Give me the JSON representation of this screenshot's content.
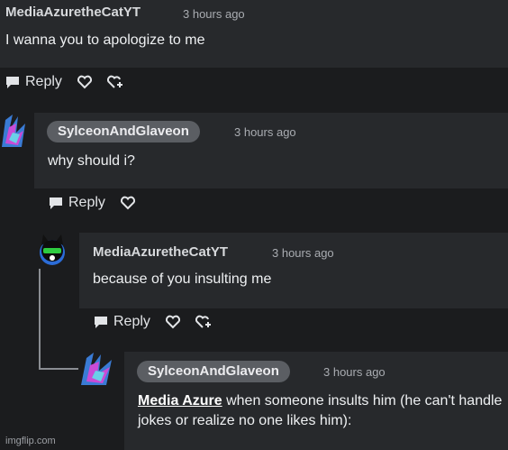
{
  "comments": [
    {
      "author": "MediaAzuretheCatYT",
      "time": "3 hours ago",
      "text": "I wanna you to apologize to me",
      "reply_label": "Reply"
    },
    {
      "author": "SylceonAndGlaveon",
      "time": "3 hours ago",
      "text": "why should i?",
      "reply_label": "Reply"
    },
    {
      "author": "MediaAzuretheCatYT",
      "time": "3 hours ago",
      "text": "because of you insulting me",
      "reply_label": "Reply"
    },
    {
      "author": "SylceonAndGlaveon",
      "time": "3 hours ago",
      "mention": "Media Azure",
      "text_after_mention": " when someone insults him (he can't handle jokes or realize no one likes him):"
    }
  ],
  "watermark": "imgflip.com",
  "colors": {
    "background": "#1b1c1e",
    "card": "#27292c",
    "pill": "#5b5e63"
  },
  "icons": [
    "comment-bubble-icon",
    "heart-icon",
    "heart-plus-icon"
  ]
}
